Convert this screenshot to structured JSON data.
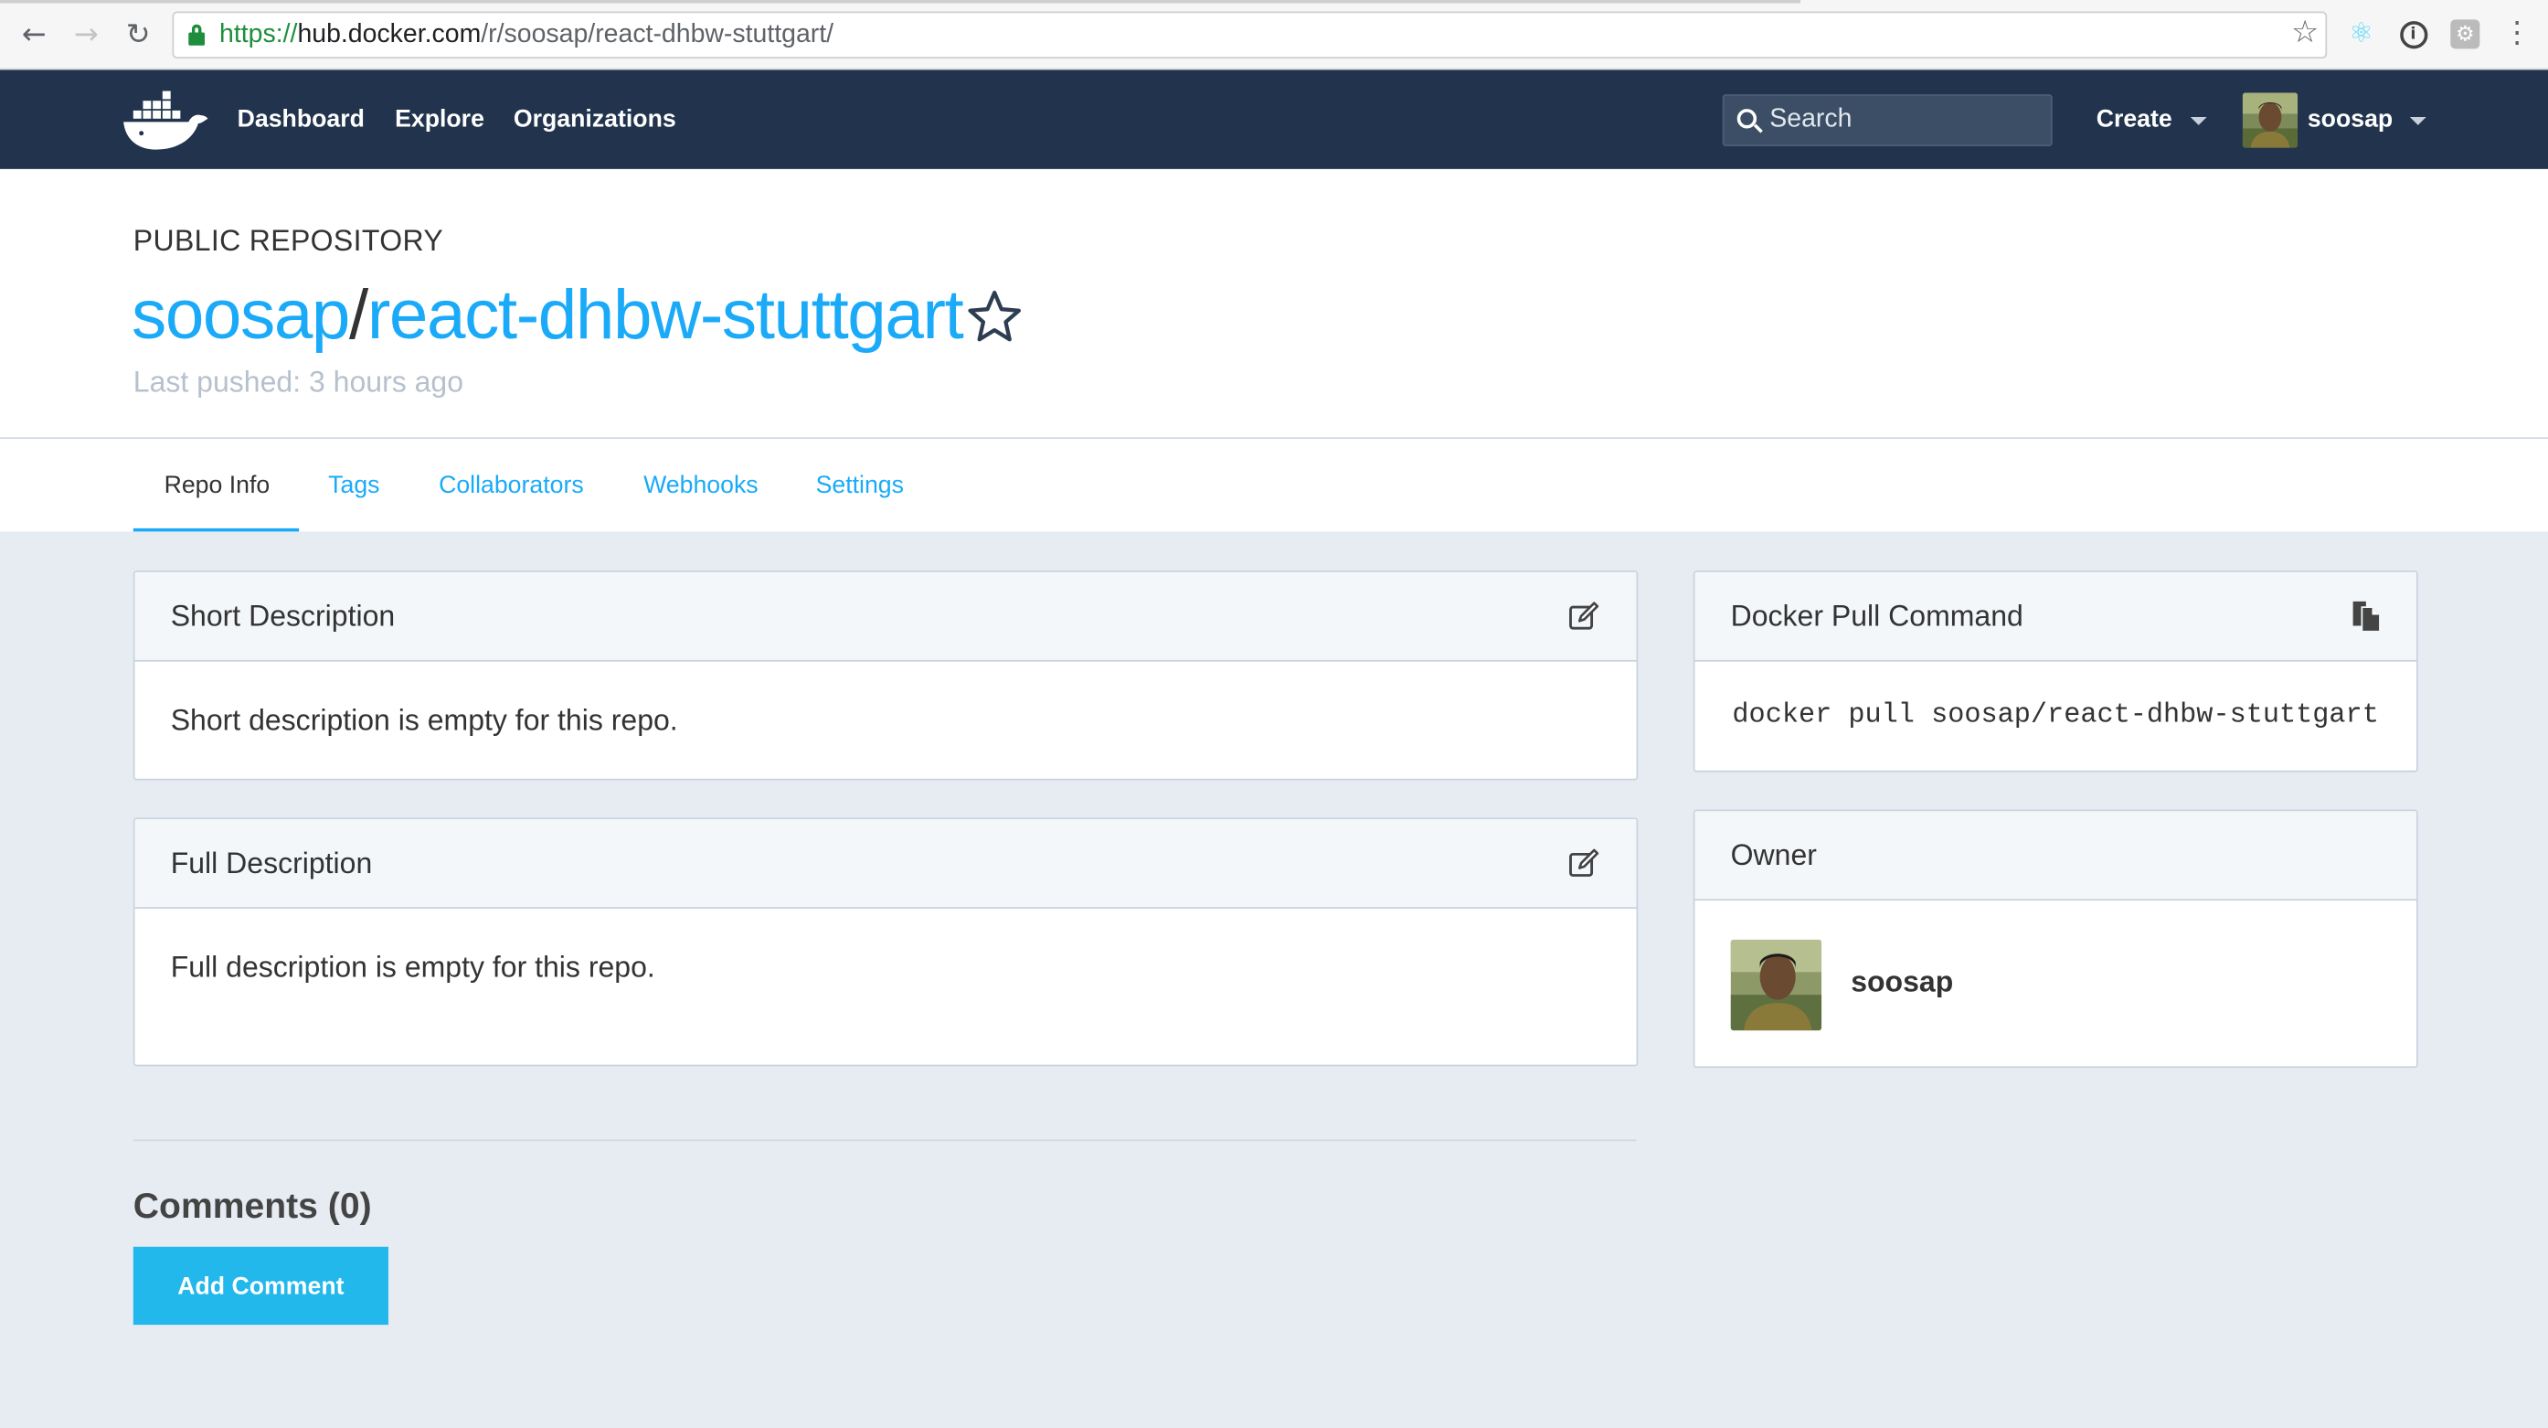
{
  "browser": {
    "url_scheme": "https://",
    "url_host": "hub.docker.com",
    "url_path": "/r/soosap/react-dhbw-stuttgart/",
    "back_icon": "←",
    "forward_icon": "→",
    "reload_icon": "↻",
    "bookmark_icon": "☆",
    "react_icon": "⚛",
    "info_icon": "i",
    "ext_icon": "⚙",
    "menu_icon": "⋮"
  },
  "navbar": {
    "links": [
      "Dashboard",
      "Explore",
      "Organizations"
    ],
    "search_placeholder": "Search",
    "create_label": "Create",
    "username": "soosap",
    "bg_color": "#22344d"
  },
  "repo": {
    "type_label": "PUBLIC REPOSITORY",
    "namespace": "soosap",
    "slash": "/",
    "name": "react-dhbw-stuttgart",
    "last_pushed": "Last pushed: 3 hours ago"
  },
  "tabs": [
    "Repo Info",
    "Tags",
    "Collaborators",
    "Webhooks",
    "Settings"
  ],
  "short_description": {
    "title": "Short Description",
    "body": "Short description is empty for this repo."
  },
  "full_description": {
    "title": "Full Description",
    "body": "Full description is empty for this repo."
  },
  "pull_command": {
    "title": "Docker Pull Command",
    "command": "docker pull soosap/react-dhbw-stuttgart"
  },
  "owner": {
    "title": "Owner",
    "name": "soosap"
  },
  "comments": {
    "title": "Comments (0)",
    "add_label": "Add Comment"
  },
  "colors": {
    "accent": "#1aaaf8",
    "button": "#22b8eb",
    "page_bg": "#e7ecf3"
  }
}
